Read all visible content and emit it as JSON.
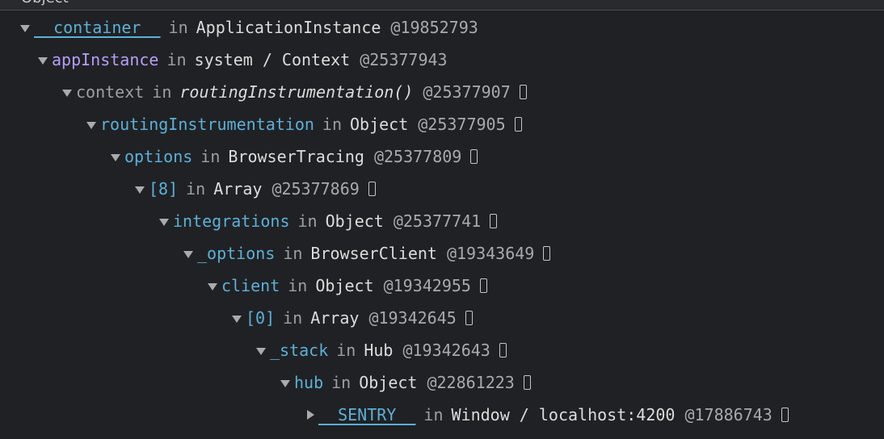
{
  "header": {
    "label": "Object"
  },
  "rows": [
    {
      "key": "__container__",
      "kw": "in",
      "obj": "ApplicationInstance",
      "addr": "@19852793"
    },
    {
      "key": "appInstance",
      "kw": "in",
      "obj": "system / Context",
      "addr": "@25377943"
    },
    {
      "key": "context",
      "kw": "in",
      "obj": "routingInstrumentation()",
      "addr": "@25377907"
    },
    {
      "key": "routingInstrumentation",
      "kw": "in",
      "obj": "Object",
      "addr": "@25377905"
    },
    {
      "key": "options",
      "kw": "in",
      "obj": "BrowserTracing",
      "addr": "@25377809"
    },
    {
      "key": "[8]",
      "kw": "in",
      "obj": "Array",
      "addr": "@25377869"
    },
    {
      "key": "integrations",
      "kw": "in",
      "obj": "Object",
      "addr": "@25377741"
    },
    {
      "key": "_options",
      "kw": "in",
      "obj": "BrowserClient",
      "addr": "@19343649"
    },
    {
      "key": "client",
      "kw": "in",
      "obj": "Object",
      "addr": "@19342955"
    },
    {
      "key": "[0]",
      "kw": "in",
      "obj": "Array",
      "addr": "@19342645"
    },
    {
      "key": "_stack",
      "kw": "in",
      "obj": "Hub",
      "addr": "@19342643"
    },
    {
      "key": "hub",
      "kw": "in",
      "obj": "Object",
      "addr": "@22861223"
    },
    {
      "key": "__SENTRY__",
      "kw": "in",
      "obj": "Window / localhost:4200",
      "addr": "@17886743"
    }
  ],
  "colors": {
    "background": "#202124",
    "key": "#5db0d7",
    "key_purple": "#b69df8",
    "key_gray": "#9aa0a6"
  },
  "icons": {
    "expanded": "triangle-down-icon",
    "collapsed": "triangle-right-icon",
    "reveal": "reveal-box-icon"
  }
}
